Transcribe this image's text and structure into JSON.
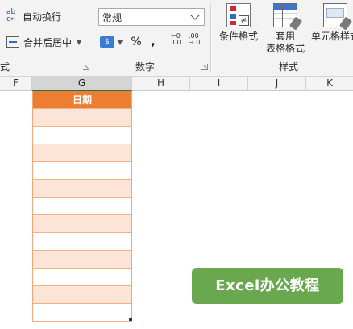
{
  "ribbon": {
    "alignment": {
      "wrap_text_label": "自动换行",
      "merge_center_label": "合并后居中",
      "group_label": "式"
    },
    "number": {
      "format_value": "常规",
      "percent_symbol": "%",
      "comma_symbol": ",",
      "group_label": "数字"
    },
    "styles": {
      "conditional_format_label": "条件格式",
      "format_as_table_label_1": "套用",
      "format_as_table_label_2": "表格格式",
      "cell_styles_label": "单元格样式",
      "group_label": "样式"
    }
  },
  "columns": [
    "F",
    "G",
    "H",
    "I",
    "J",
    "K"
  ],
  "active_column": "G",
  "table": {
    "header": "日期",
    "row_count": 12,
    "header_color": "#ed7d31",
    "band_color": "#fce4d6"
  },
  "watermark": {
    "text": "Excel办公教程",
    "color": "#6aa84f"
  }
}
